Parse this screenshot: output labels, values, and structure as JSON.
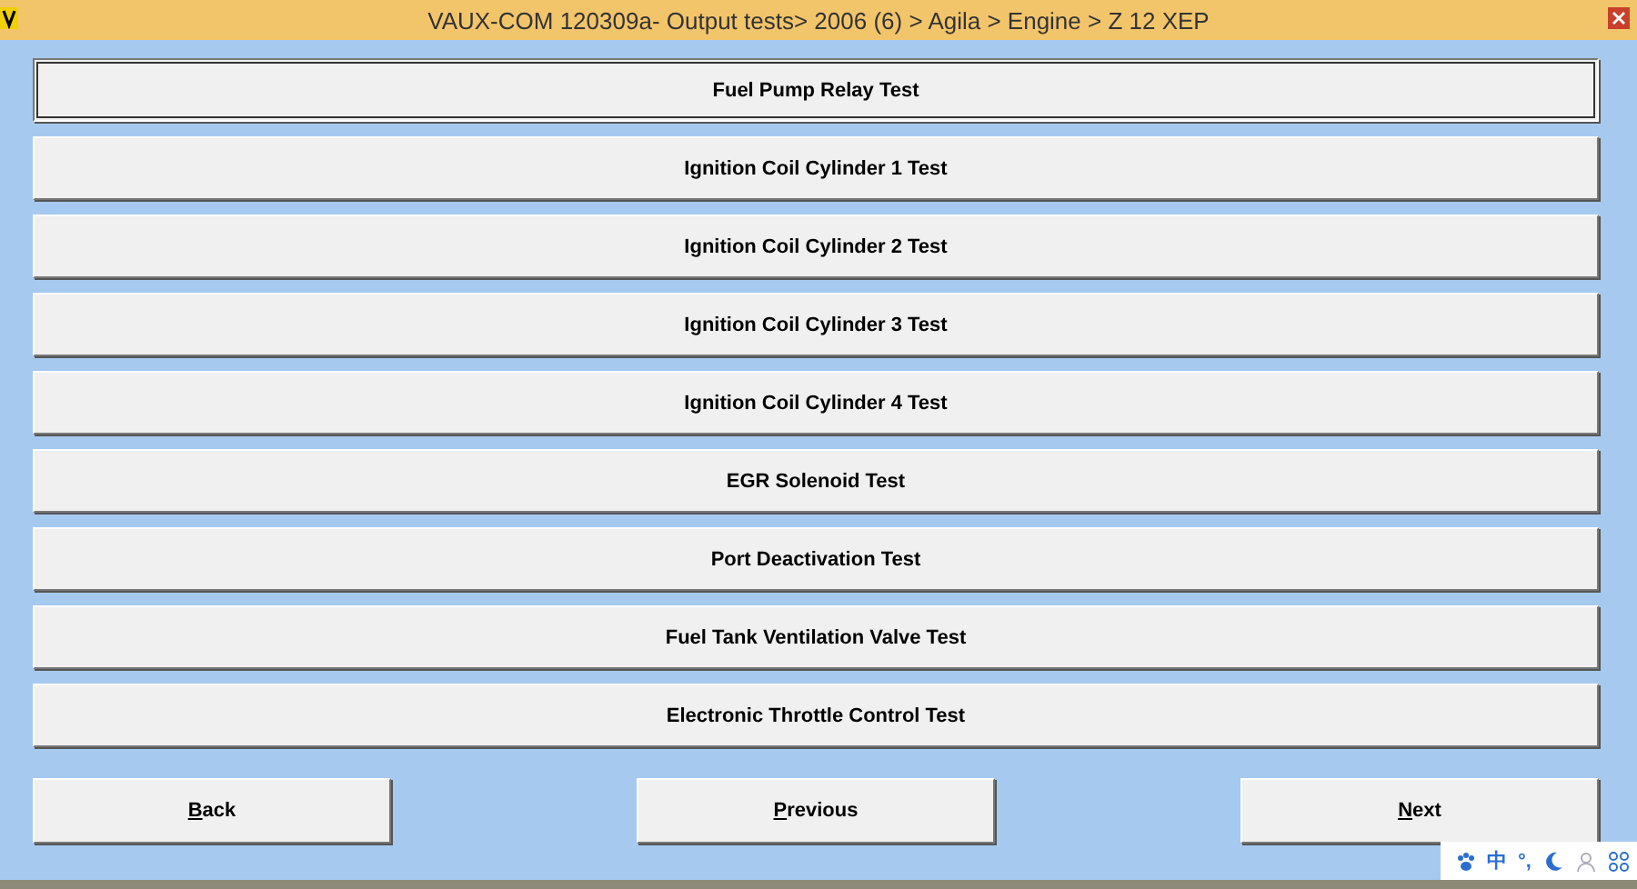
{
  "window": {
    "title": "VAUX-COM 120309a- Output tests> 2006 (6) > Agila > Engine > Z 12 XEP"
  },
  "tests": [
    {
      "label": "Fuel Pump Relay Test",
      "selected": true
    },
    {
      "label": "Ignition Coil Cylinder 1 Test",
      "selected": false
    },
    {
      "label": "Ignition Coil Cylinder 2 Test",
      "selected": false
    },
    {
      "label": "Ignition Coil Cylinder 3 Test",
      "selected": false
    },
    {
      "label": "Ignition Coil Cylinder 4 Test",
      "selected": false
    },
    {
      "label": "EGR Solenoid Test",
      "selected": false
    },
    {
      "label": "Port Deactivation Test",
      "selected": false
    },
    {
      "label": "Fuel Tank Ventilation Valve Test",
      "selected": false
    },
    {
      "label": "Electronic Throttle Control Test",
      "selected": false
    }
  ],
  "nav_buttons": [
    {
      "label": "Back",
      "mnemonic": true
    },
    {
      "label": "Previous",
      "mnemonic": true
    },
    {
      "label": "Next",
      "mnemonic": true
    }
  ],
  "ime_bar": {
    "mode": "中",
    "punctuation": "°,"
  }
}
